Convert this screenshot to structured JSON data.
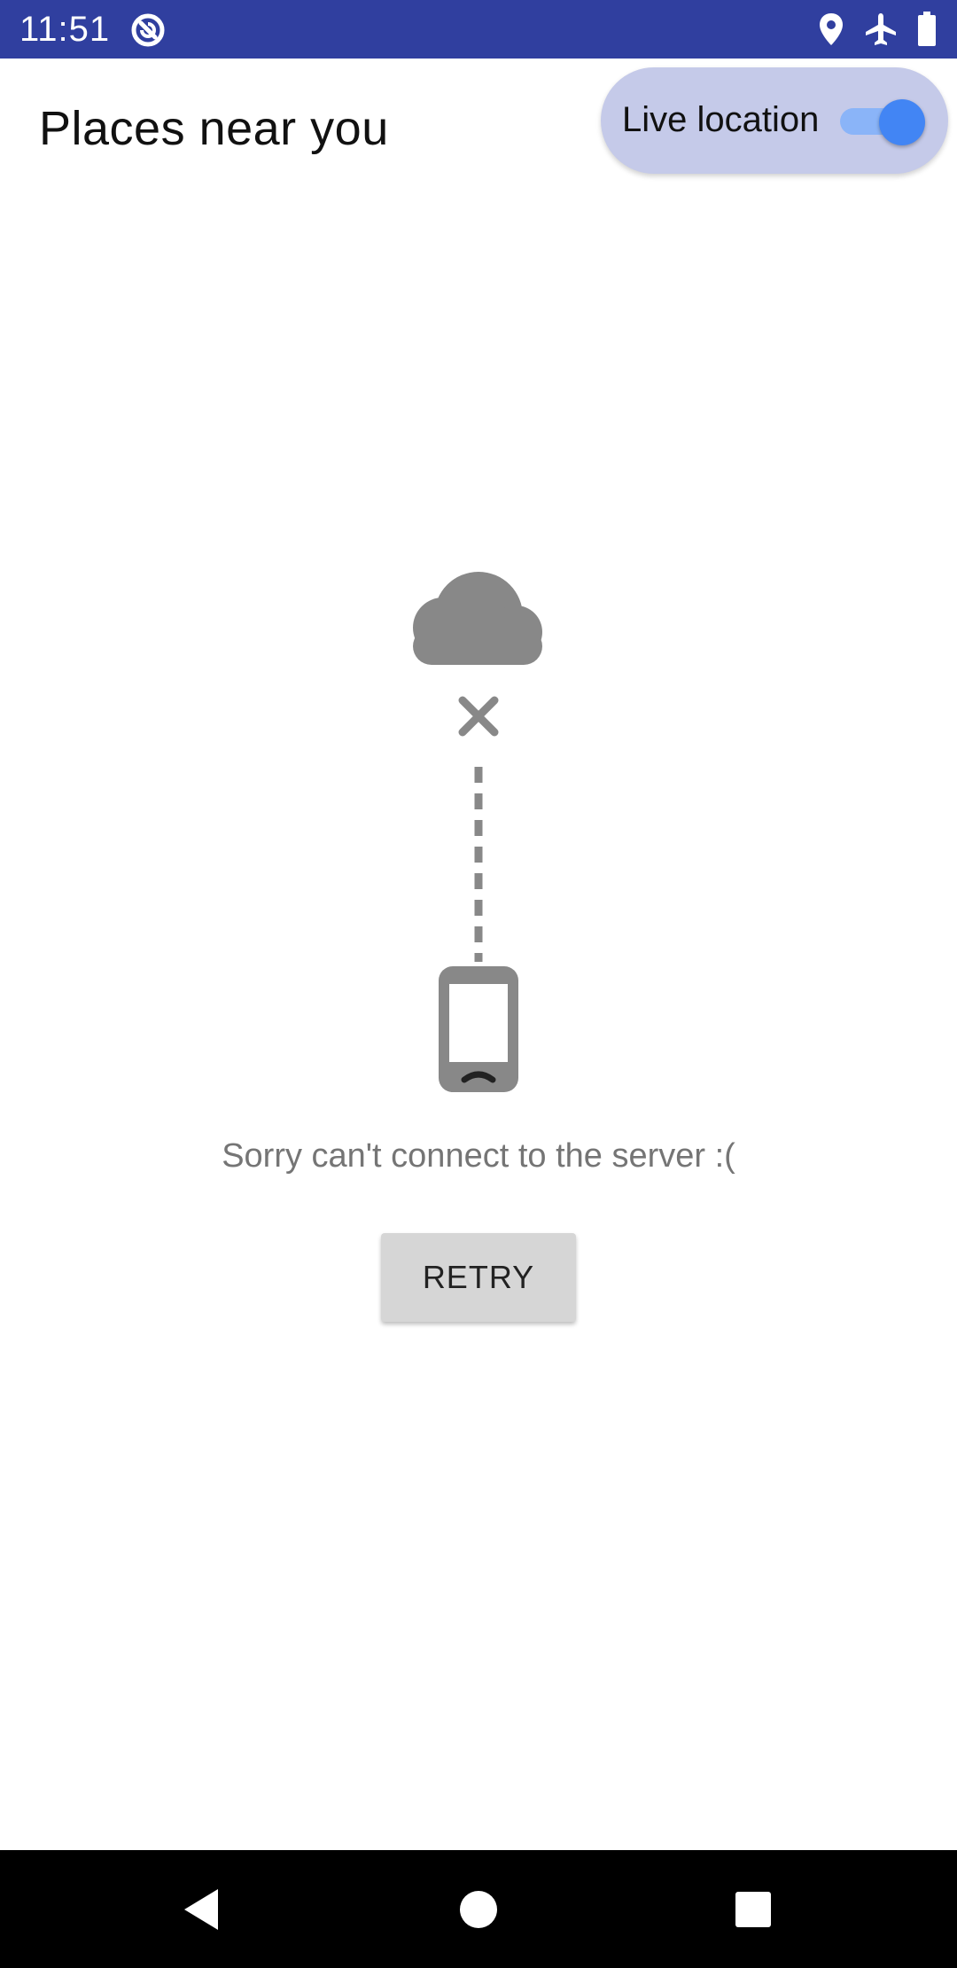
{
  "status_bar": {
    "time": "11:51",
    "background": "#303f9f",
    "icons": [
      "app-notification-icon",
      "location-pin-icon",
      "airplane-mode-icon",
      "battery-icon"
    ]
  },
  "header": {
    "title": "Places near you"
  },
  "live_location": {
    "label": "Live location",
    "enabled": true,
    "chip_color": "#c5cae9",
    "toggle_color": "#4285f4"
  },
  "error_state": {
    "icons": [
      "cloud-icon",
      "disconnect-x-icon",
      "dashed-connection-line",
      "sad-phone-icon"
    ],
    "message": "Sorry can't connect to the server :(",
    "retry_label": "RETRY"
  },
  "nav_bar": {
    "buttons": [
      "back-icon",
      "home-icon",
      "recents-icon"
    ]
  }
}
